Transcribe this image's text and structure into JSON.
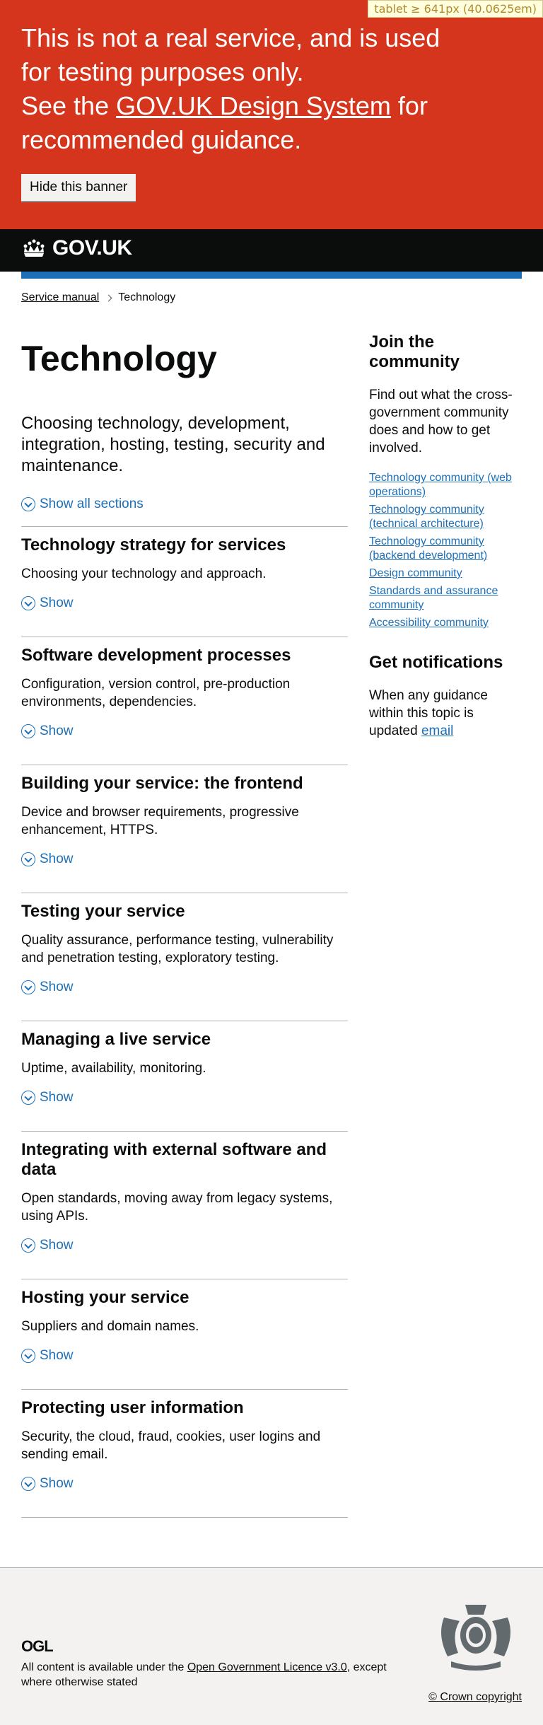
{
  "badge": "tablet ≥ 641px (40.0625em)",
  "banner": {
    "line1": "This is not a real service, and is used for testing purposes only.",
    "line2_prefix": "See the ",
    "link": "GOV.UK Design System",
    "line2_suffix": " for recommended guidance.",
    "hide_button": "Hide this banner"
  },
  "header": {
    "logo_text": "GOV.UK"
  },
  "breadcrumb": {
    "home": "Service manual",
    "current": "Technology"
  },
  "page": {
    "title": "Technology",
    "lede": "Choosing technology, development, integration, hosting, testing, security and maintenance.",
    "show_all": "Show all sections"
  },
  "sections": [
    {
      "title": "Technology strategy for services",
      "summary": "Choosing your technology and approach.",
      "show": "Show"
    },
    {
      "title": "Software development processes",
      "summary": "Configuration, version control, pre-production environments, dependencies.",
      "show": "Show"
    },
    {
      "title": "Building your service: the frontend",
      "summary": "Device and browser requirements, progressive enhancement, HTTPS.",
      "show": "Show"
    },
    {
      "title": "Testing your service",
      "summary": "Quality assurance, performance testing, vulnerability and penetration testing, exploratory testing.",
      "show": "Show"
    },
    {
      "title": "Managing a live service",
      "summary": "Uptime, availability, monitoring.",
      "show": "Show"
    },
    {
      "title": "Integrating with external software and data",
      "summary": "Open standards, moving away from legacy systems, using APIs.",
      "show": "Show"
    },
    {
      "title": "Hosting your service",
      "summary": "Suppliers and domain names.",
      "show": "Show"
    },
    {
      "title": "Protecting user information",
      "summary": "Security, the cloud, fraud, cookies, user logins and sending email.",
      "show": "Show"
    }
  ],
  "aside": {
    "community_title": "Join the community",
    "community_text": "Find out what the cross-government community does and how to get involved.",
    "links": [
      "Technology community (web operations)",
      "Technology community (technical architecture)",
      "Technology community (backend development)",
      "Design community",
      "Standards and assurance community",
      "Accessibility community"
    ],
    "notif_title": "Get notifications",
    "notif_text": "When any guidance within this topic is updated ",
    "notif_link": "email"
  },
  "footer": {
    "ogl": "OGL",
    "licence_prefix": "All content is available under the ",
    "licence_link": "Open Government Licence v3.0",
    "licence_suffix": ", except where otherwise stated",
    "copyright": "© Crown copyright"
  },
  "colors": {
    "banner": "#d4351c",
    "header": "#0b0c0c",
    "link": "#1d70b8",
    "footer": "#f3f2f1"
  }
}
